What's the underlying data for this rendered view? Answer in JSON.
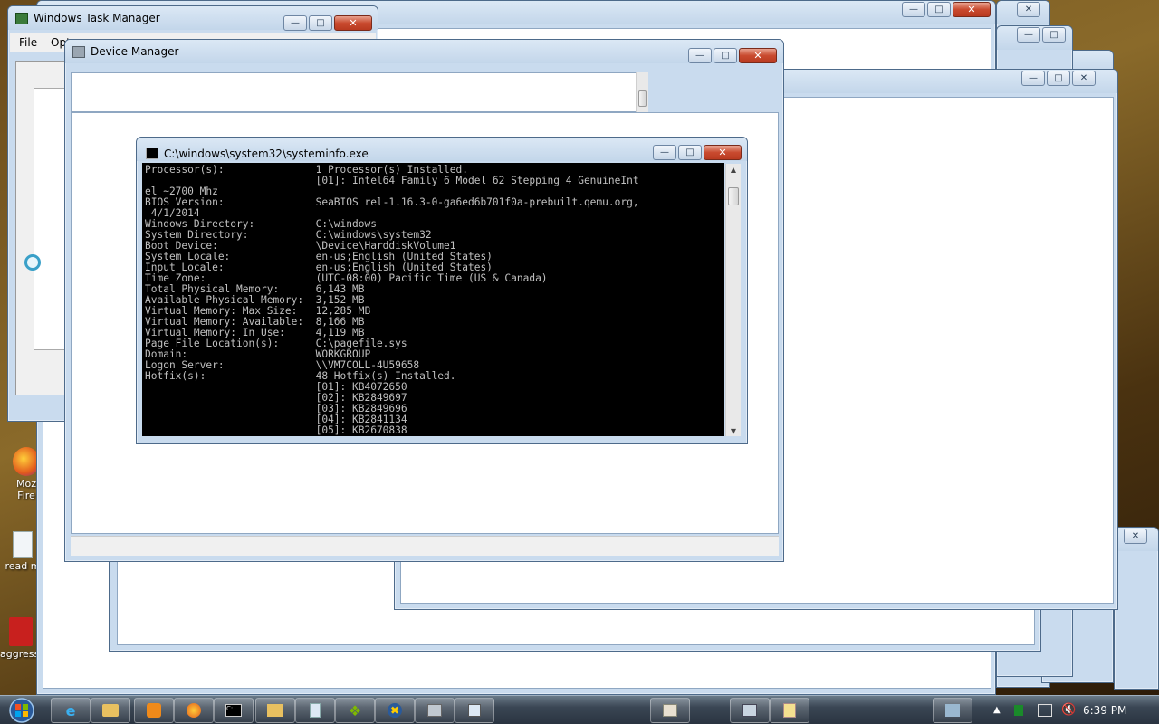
{
  "desktop": {
    "icons": [
      {
        "label": "Moz Fire",
        "line1": "Moz",
        "line2": "Fire",
        "color": "#e25a1c"
      },
      {
        "label": "read m",
        "line1": "read m",
        "line2": "",
        "color": "#dfe8f0"
      },
      {
        "label": "aggressi",
        "line1": "aggressi",
        "line2": "",
        "color": "#c8201e"
      }
    ]
  },
  "task_manager": {
    "title": "Windows Task Manager",
    "menu": [
      "File",
      "Opt"
    ]
  },
  "device_manager": {
    "title": "Device Manager"
  },
  "console": {
    "title": "C:\\windows\\system32\\systeminfo.exe",
    "lines": [
      "Processor(s):               1 Processor(s) Installed.",
      "                            [01]: Intel64 Family 6 Model 62 Stepping 4 GenuineInt",
      "el ~2700 Mhz",
      "BIOS Version:               SeaBIOS rel-1.16.3-0-ga6ed6b701f0a-prebuilt.qemu.org,",
      " 4/1/2014",
      "Windows Directory:          C:\\windows",
      "System Directory:           C:\\windows\\system32",
      "Boot Device:                \\Device\\HarddiskVolume1",
      "System Locale:              en-us;English (United States)",
      "Input Locale:               en-us;English (United States)",
      "Time Zone:                  (UTC-08:00) Pacific Time (US & Canada)",
      "Total Physical Memory:      6,143 MB",
      "Available Physical Memory:  3,152 MB",
      "Virtual Memory: Max Size:   12,285 MB",
      "Virtual Memory: Available:  8,166 MB",
      "Virtual Memory: In Use:     4,119 MB",
      "Page File Location(s):      C:\\pagefile.sys",
      "Domain:                     WORKGROUP",
      "Logon Server:               \\\\VM7COLL-4U59658",
      "Hotfix(s):                  48 Hotfix(s) Installed.",
      "                            [01]: KB4072650",
      "                            [02]: KB2849697",
      "                            [03]: KB2849696",
      "                            [04]: KB2841134",
      "                            [05]: KB2670838"
    ]
  },
  "taskbar": {
    "clock": "6:39 PM",
    "buttons": [
      "ie-icon",
      "explorer-icon",
      "media-player-icon",
      "firefox-icon",
      "cmd-icon",
      "folder-icon",
      "notepad-icon",
      "windows-icon",
      "security-icon",
      "device-manager-icon",
      "task-manager-icon",
      "paint-icon",
      "network-icon",
      "notes-icon"
    ]
  },
  "colors": {
    "console_bg": "#000000",
    "console_text": "#c0c0c0",
    "close_button": "#c94a2f",
    "window_frame": "#c9dbee"
  }
}
